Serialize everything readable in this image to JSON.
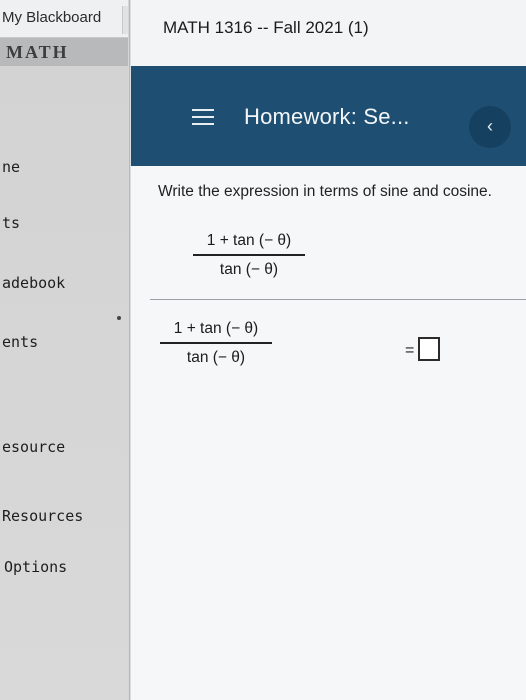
{
  "left_window": {
    "tab_title": "My Blackboard",
    "banner_text": "MATH",
    "nav_items": [
      {
        "label": "ne"
      },
      {
        "label": "ts"
      },
      {
        "label": "adebook"
      },
      {
        "label": "ents"
      },
      {
        "label": "esource"
      },
      {
        "label": "Resources"
      },
      {
        "label": "Options"
      }
    ]
  },
  "right_window": {
    "tab_title": "MATH 1316 -- Fall 2021 (1)",
    "header": {
      "title": "Homework: Se...",
      "back_symbol": "‹"
    },
    "question": {
      "instruction": "Write the expression in terms of sine and cosine.",
      "expression_numerator": "1 + tan (− θ)",
      "expression_denominator": "tan (− θ)",
      "answer_equals": "=",
      "answer_value": ""
    }
  },
  "colors": {
    "header_bg": "#1e4e72",
    "back_button_bg": "#16405f",
    "content_bg": "#f5f7f8"
  },
  "icons": [
    "hamburger-menu-icon",
    "chevron-left-icon",
    "mouse-pointer-icon"
  ]
}
